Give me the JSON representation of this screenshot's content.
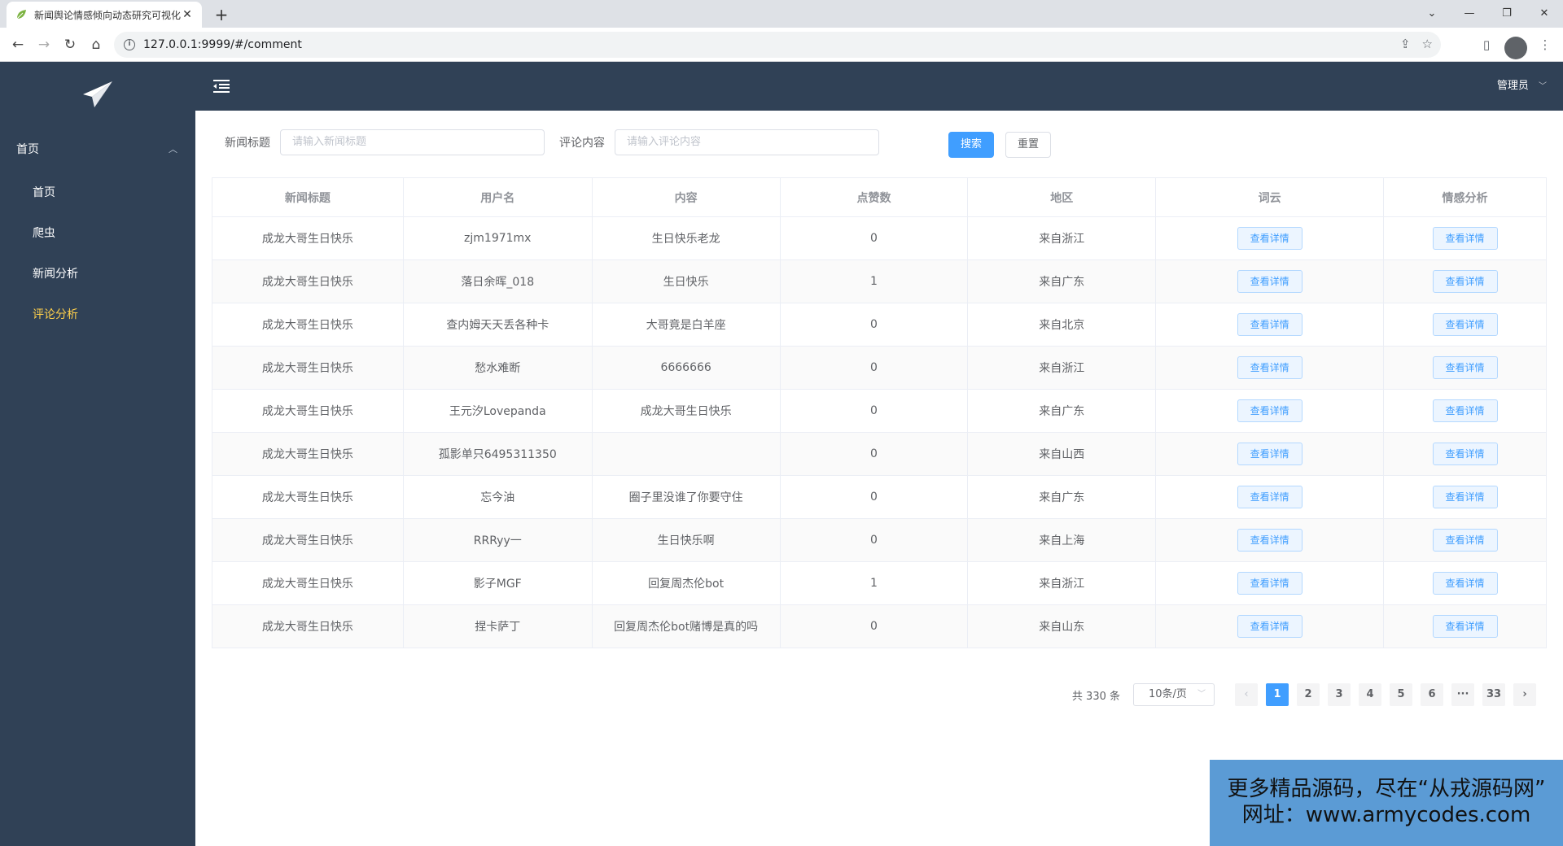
{
  "browser": {
    "tab_title": "新闻舆论情感倾向动态研究可视化",
    "tab_close": "✕",
    "new_tab": "+",
    "url": "127.0.0.1:9999/#/comment"
  },
  "sidebar": {
    "group_label": "首页",
    "items": [
      {
        "label": "首页"
      },
      {
        "label": "爬虫"
      },
      {
        "label": "新闻分析"
      },
      {
        "label": "评论分析"
      }
    ]
  },
  "topbar": {
    "user_label": "管理员"
  },
  "filters": {
    "title_label": "新闻标题",
    "title_placeholder": "请输入新闻标题",
    "content_label": "评论内容",
    "content_placeholder": "请输入评论内容",
    "search_button": "搜索",
    "reset_button": "重置"
  },
  "table": {
    "headers": [
      "新闻标题",
      "用户名",
      "内容",
      "点赞数",
      "地区",
      "词云",
      "情感分析"
    ],
    "detail_label": "查看详情",
    "rows": [
      {
        "title": "成龙大哥生日快乐",
        "user": "zjm1971mx",
        "content": "生日快乐老龙",
        "likes": "0",
        "region": "来自浙江"
      },
      {
        "title": "成龙大哥生日快乐",
        "user": "落日余晖_018",
        "content": "生日快乐",
        "likes": "1",
        "region": "来自广东"
      },
      {
        "title": "成龙大哥生日快乐",
        "user": "查内姆天天丢各种卡",
        "content": "大哥竟是白羊座",
        "likes": "0",
        "region": "来自北京"
      },
      {
        "title": "成龙大哥生日快乐",
        "user": "愁水难断",
        "content": "6666666",
        "likes": "0",
        "region": "来自浙江"
      },
      {
        "title": "成龙大哥生日快乐",
        "user": "王元汐Lovepanda",
        "content": "成龙大哥生日快乐",
        "likes": "0",
        "region": "来自广东"
      },
      {
        "title": "成龙大哥生日快乐",
        "user": "孤影单只6495311350",
        "content": "",
        "likes": "0",
        "region": "来自山西"
      },
      {
        "title": "成龙大哥生日快乐",
        "user": "忘今油",
        "content": "圈子里没谁了你要守住",
        "likes": "0",
        "region": "来自广东"
      },
      {
        "title": "成龙大哥生日快乐",
        "user": "RRRyy一",
        "content": "生日快乐啊",
        "likes": "0",
        "region": "来自上海"
      },
      {
        "title": "成龙大哥生日快乐",
        "user": "影子MGF",
        "content": "回复周杰伦bot",
        "likes": "1",
        "region": "来自浙江"
      },
      {
        "title": "成龙大哥生日快乐",
        "user": "捏卡萨丁",
        "content": "回复周杰伦bot赌博是真的吗",
        "likes": "0",
        "region": "来自山东"
      }
    ]
  },
  "pagination": {
    "total": "共 330 条",
    "page_size": "10条/页",
    "pages": [
      "1",
      "2",
      "3",
      "4",
      "5",
      "6",
      "···",
      "33"
    ],
    "current": "1"
  },
  "watermark": {
    "line1": "更多精品源码，尽在“从戎源码网”",
    "line2": "网址：www.armycodes.com"
  },
  "colors": {
    "sidebar_bg": "#304156",
    "active_menu": "#ffd04b",
    "primary": "#409eff"
  }
}
